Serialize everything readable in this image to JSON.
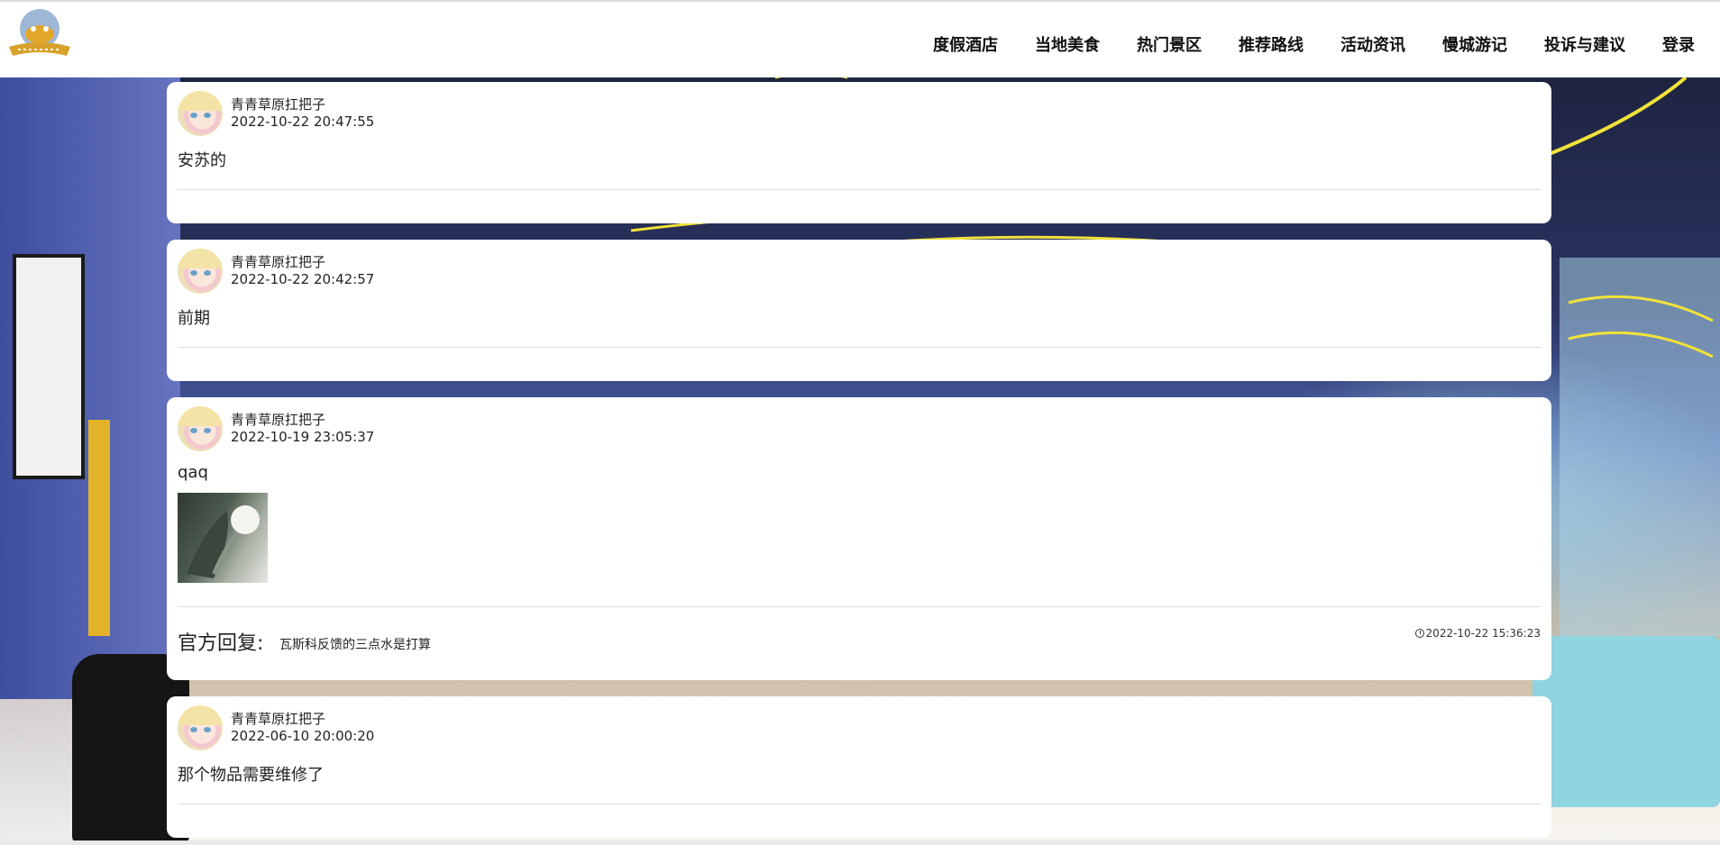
{
  "header": {
    "logo_icon": "crab-mascot-logo-icon",
    "nav": [
      {
        "label": "度假酒店"
      },
      {
        "label": "当地美食"
      },
      {
        "label": "热门景区"
      },
      {
        "label": "推荐路线"
      },
      {
        "label": "活动资讯"
      },
      {
        "label": "慢城游记"
      },
      {
        "label": "投诉与建议"
      },
      {
        "label": "登录"
      }
    ]
  },
  "posts": [
    {
      "username": "青青草原扛把子",
      "datetime": "2022-10-22 20:47:55",
      "content": "安苏的"
    },
    {
      "username": "青青草原扛把子",
      "datetime": "2022-10-22 20:42:57",
      "content": "前期"
    },
    {
      "username": "青青草原扛把子",
      "datetime": "2022-10-19 23:05:37",
      "content": "qaq",
      "reply": {
        "label": "官方回复:",
        "text": "瓦斯科反馈的三点水是打算",
        "time": "2022-10-22 15:36:23"
      }
    },
    {
      "username": "青青草原扛把子",
      "datetime": "2022-06-10 20:00:20",
      "content": "那个物品需要维修了"
    }
  ],
  "colors": {
    "nav_text": "#111111",
    "card_bg": "#ffffff",
    "divider": "#dcdcdc"
  }
}
